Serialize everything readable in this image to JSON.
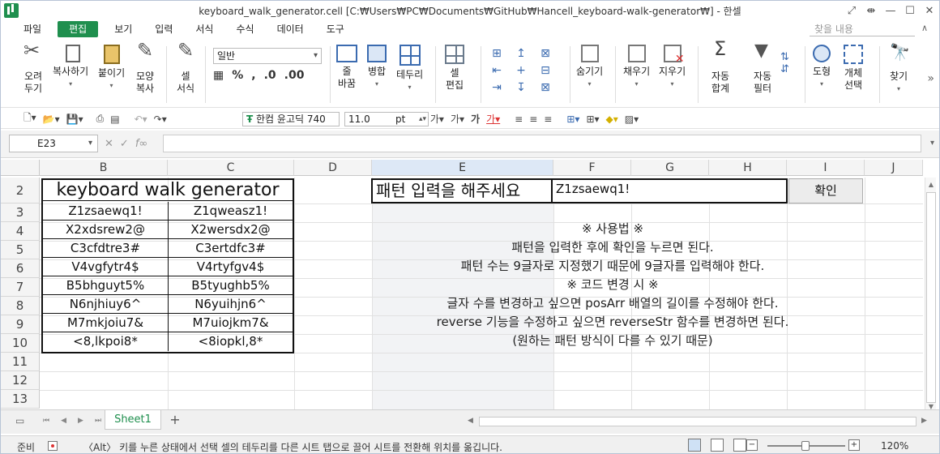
{
  "window": {
    "title": "keyboard_walk_generator.cell [C:₩Users₩PC₩Documents₩GitHub₩Hancell_keyboard-walk-generator₩] - 한셀",
    "controls": [
      "⤢",
      "⇼",
      "—",
      "☐",
      "✕"
    ]
  },
  "menu": {
    "items": [
      "파일",
      "편집",
      "보기",
      "입력",
      "서식",
      "수식",
      "데이터",
      "도구"
    ],
    "active_index": 1,
    "find_placeholder": "찾을 내용"
  },
  "ribbon": {
    "cut": [
      "오려",
      "두기"
    ],
    "copy": "복사하기",
    "paste": "붙이기",
    "format_painter": [
      "모양",
      "복사"
    ],
    "cell_format": [
      "셀",
      "서식"
    ],
    "number_format": "일반",
    "wrap": [
      "줄",
      "바꿈"
    ],
    "merge": "병합",
    "border": "테두리",
    "cell_edit": [
      "셀",
      "편집"
    ],
    "hide": "숨기기",
    "fill": "채우기",
    "clear": "지우기",
    "autosum": [
      "자동",
      "합계"
    ],
    "autofilter": [
      "자동",
      "필터"
    ],
    "shape": "도형",
    "select_object": [
      "개체",
      "선택"
    ],
    "find": "찾기"
  },
  "toolbar2": {
    "font_name": "한컴 윤고딕 740",
    "font_size": "11.0",
    "font_unit": "pt"
  },
  "formula_bar": {
    "name_box": "E23",
    "formula": ""
  },
  "sheet": {
    "columns": [
      "B",
      "C",
      "D",
      "E",
      "F",
      "G",
      "H",
      "I",
      "J"
    ],
    "selected_column": "E",
    "rows": [
      "2",
      "3",
      "4",
      "5",
      "6",
      "7",
      "8",
      "9",
      "10",
      "11",
      "12",
      "13"
    ],
    "table_title": "keyboard walk generator",
    "table": [
      [
        "Z1zsaewq1!",
        "Z1qweasz1!"
      ],
      [
        "X2xdsrew2@",
        "X2wersdx2@"
      ],
      [
        "C3cfdtre3#",
        "C3ertdfc3#"
      ],
      [
        "V4vgfytr4$",
        "V4rtyfgv4$"
      ],
      [
        "B5bhguyt5%",
        "B5tyughb5%"
      ],
      [
        "N6njhiuy6^",
        "N6yuihjn6^"
      ],
      [
        "M7mkjoiu7&",
        "M7uiojkm7&"
      ],
      [
        "<8,lkpoi8*",
        "<8iopkl,8*"
      ]
    ],
    "prompt_label": "패턴 입력을 해주세요",
    "prompt_value": "Z1zsaewq1!",
    "confirm_button": "확인",
    "usage_lines": [
      "※ 사용법 ※",
      "패턴을 입력한 후에 확인을 누르면 된다.",
      "패턴 수는 9글자로 지정했기 때문에 9글자를 입력해야 한다.",
      "※ 코드 변경 시 ※",
      "글자 수를 변경하고 싶으면 posArr 배열의 길이를 수정해야 한다.",
      "reverse 기능을 수정하고 싶으면 reverseStr 함수를 변경하면 된다.",
      "(원하는 패턴 방식이 다를 수 있기 때문)"
    ]
  },
  "tabs": {
    "sheet_name": "Sheet1",
    "add_label": "+"
  },
  "status": {
    "ready": "준비",
    "hint": "〈Alt〉 키를 누른 상태에서 선택 셀의 테두리를 다른 시트 탭으로 끌어 시트를 전환해 위치를 옮깁니다.",
    "zoom": "120%"
  }
}
